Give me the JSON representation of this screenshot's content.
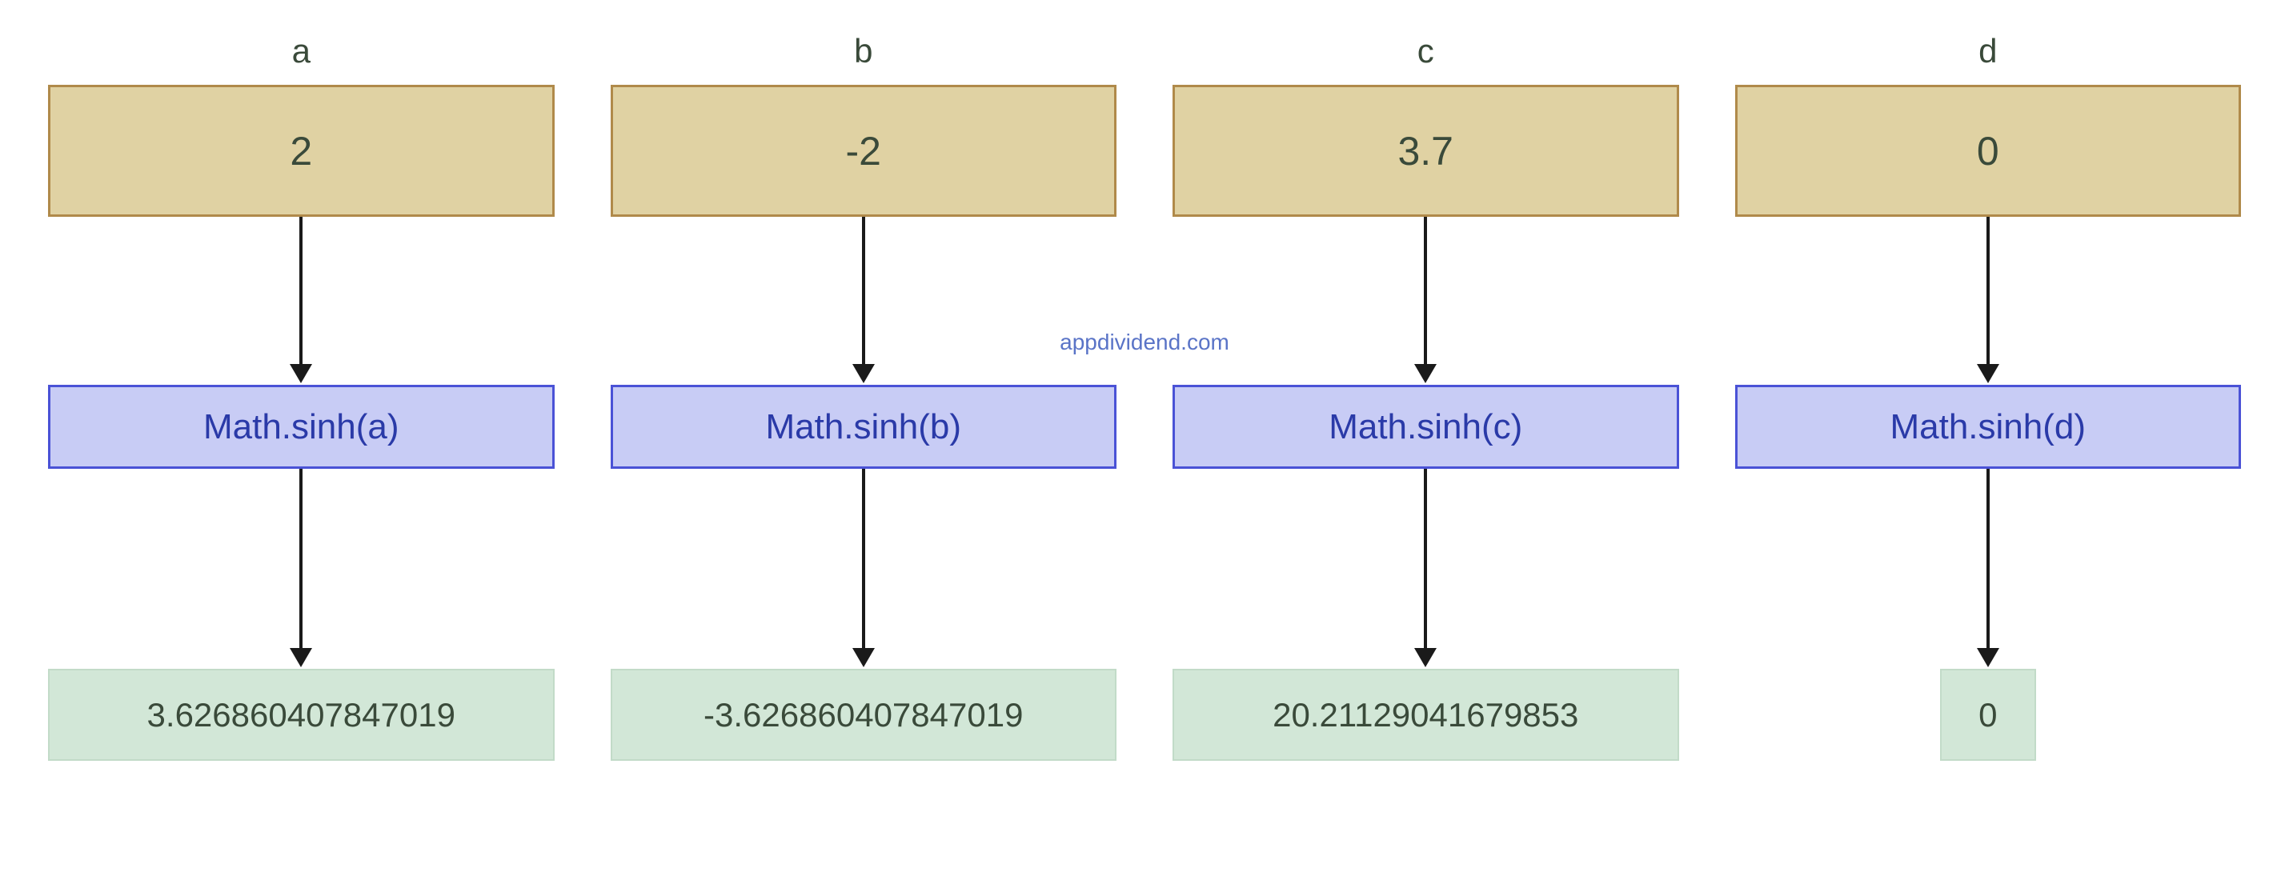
{
  "watermark": "appdividend.com",
  "columns": [
    {
      "var": "a",
      "input": "2",
      "fn": "Math.sinh(a)",
      "output": "3.626860407847019"
    },
    {
      "var": "b",
      "input": "-2",
      "fn": "Math.sinh(b)",
      "output": "-3.626860407847019"
    },
    {
      "var": "c",
      "input": "3.7",
      "fn": "Math.sinh(c)",
      "output": "20.21129041679853"
    },
    {
      "var": "d",
      "input": "0",
      "fn": "Math.sinh(d)",
      "output": "0"
    }
  ]
}
